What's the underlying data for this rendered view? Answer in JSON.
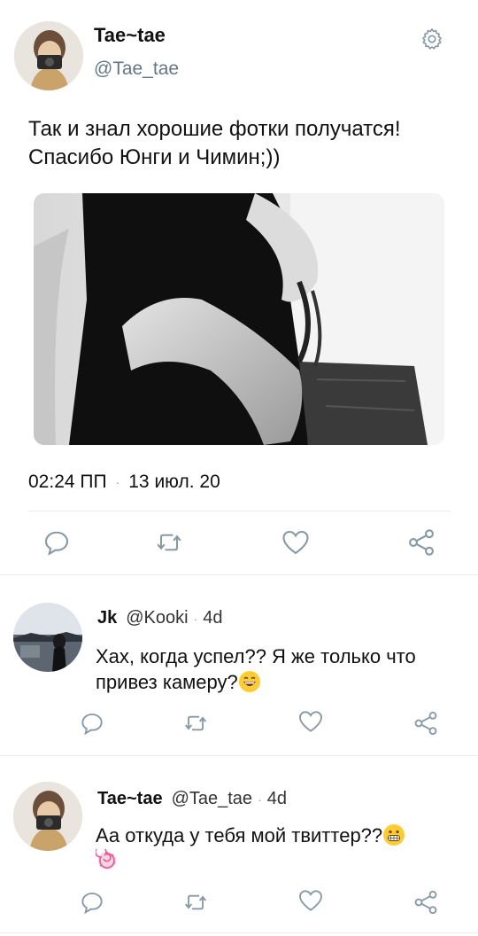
{
  "tweet": {
    "author_name": "Tae~tae",
    "author_handle": "@Tae_tae",
    "text": "Так и знал хорошие фотки получатся! Спасибо Юнги и Чимин;))",
    "time": "02:24 ПП",
    "date": "13 июл. 20",
    "icons": {
      "settings": "gear-icon",
      "reply": "reply-icon",
      "retweet": "retweet-icon",
      "like": "heart-icon",
      "share": "share-icon"
    }
  },
  "replies": [
    {
      "name": "Jk",
      "handle": "@Kooki",
      "time": "4d",
      "text": "Хах, когда успел?? Я же только что привез камеру?",
      "emoji": "grinning-face-icon"
    },
    {
      "name": "Tae~tae",
      "handle": "@Tae_tae",
      "time": "4d",
      "text": "Аа откуда у тебя мой твиттер??",
      "emoji": "grimacing-face-icon",
      "emoji2": "lollipop-icon"
    }
  ],
  "colors": {
    "icon_gray": "#8899a6",
    "divider": "#e6ecf0",
    "handle_gray": "#657786"
  }
}
